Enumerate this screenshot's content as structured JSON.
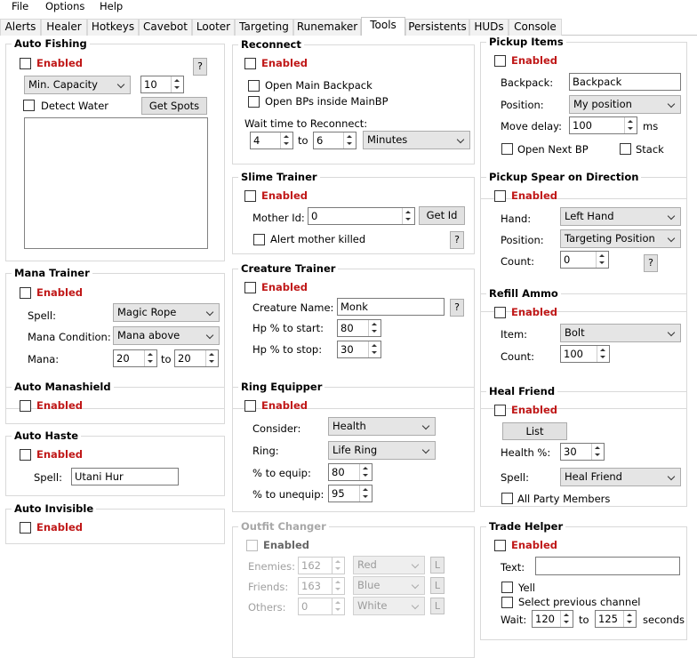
{
  "menu": [
    "File",
    "Options",
    "Help"
  ],
  "tabs": [
    "Alerts",
    "Healer",
    "Hotkeys",
    "Cavebot",
    "Looter",
    "Targeting",
    "Runemaker",
    "Tools",
    "Persistents",
    "HUDs",
    "Console"
  ],
  "active_tab": "Tools",
  "enabled_label": "Enabled",
  "help": "?",
  "colors": {
    "enabled_red": "#c01818",
    "disabled_gray": "#a0a0a0"
  },
  "auto_fishing": {
    "title": "Auto Fishing",
    "condition": "Min. Capacity",
    "value": "10",
    "detect_water": "Detect Water",
    "get_spots": "Get Spots"
  },
  "mana_trainer": {
    "title": "Mana Trainer",
    "spell_label": "Spell:",
    "spell": "Magic Rope",
    "cond_label": "Mana Condition:",
    "cond": "Mana above",
    "mana_label": "Mana:",
    "min": "20",
    "to": "to",
    "max": "20"
  },
  "auto_manashield": {
    "title": "Auto Manashield"
  },
  "auto_haste": {
    "title": "Auto Haste",
    "spell_label": "Spell:",
    "spell": "Utani Hur"
  },
  "auto_invisible": {
    "title": "Auto Invisible"
  },
  "reconnect": {
    "title": "Reconnect",
    "open_main": "Open Main Backpack",
    "open_bps": "Open BPs inside MainBP",
    "wait_label": "Wait time to Reconnect:",
    "min": "4",
    "to": "to",
    "max": "6",
    "unit": "Minutes"
  },
  "slime_trainer": {
    "title": "Slime Trainer",
    "mother_label": "Mother Id:",
    "mother": "0",
    "get_id": "Get Id",
    "alert": "Alert mother killed"
  },
  "creature_trainer": {
    "title": "Creature Trainer",
    "name_label": "Creature Name:",
    "name": "Monk",
    "start_label": "Hp % to start:",
    "start": "80",
    "stop_label": "Hp % to stop:",
    "stop": "30"
  },
  "ring_equipper": {
    "title": "Ring Equipper",
    "consider_label": "Consider:",
    "consider": "Health",
    "ring_label": "Ring:",
    "ring": "Life Ring",
    "equip_label": "% to equip:",
    "equip": "80",
    "unequip_label": "% to unequip:",
    "unequip": "95"
  },
  "outfit_changer": {
    "title": "Outfit Changer",
    "rows": [
      {
        "label": "Enemies:",
        "value": "162",
        "color": "Red",
        "btn": "L"
      },
      {
        "label": "Friends:",
        "value": "163",
        "color": "Blue",
        "btn": "L"
      },
      {
        "label": "Others:",
        "value": "0",
        "color": "White",
        "btn": "L"
      }
    ]
  },
  "pickup_items": {
    "title": "Pickup Items",
    "backpack_label": "Backpack:",
    "backpack": "Backpack",
    "position_label": "Position:",
    "position": "My position",
    "delay_label": "Move delay:",
    "delay": "100",
    "ms": "ms",
    "open_next": "Open Next BP",
    "stack": "Stack"
  },
  "pickup_spear": {
    "title": "Pickup Spear on Direction",
    "hand_label": "Hand:",
    "hand": "Left Hand",
    "position_label": "Position:",
    "position": "Targeting Position",
    "count_label": "Count:",
    "count": "0"
  },
  "refill_ammo": {
    "title": "Refill Ammo",
    "item_label": "Item:",
    "item": "Bolt",
    "count_label": "Count:",
    "count": "100"
  },
  "heal_friend": {
    "title": "Heal Friend",
    "list": "List",
    "health_label": "Health %:",
    "health": "30",
    "spell_label": "Spell:",
    "spell": "Heal Friend",
    "all_party": "All Party Members"
  },
  "trade_helper": {
    "title": "Trade Helper",
    "text_label": "Text:",
    "text": "",
    "yell": "Yell",
    "select_prev": "Select previous channel",
    "wait_label": "Wait:",
    "min": "120",
    "to": "to",
    "max": "125",
    "seconds": "seconds"
  }
}
